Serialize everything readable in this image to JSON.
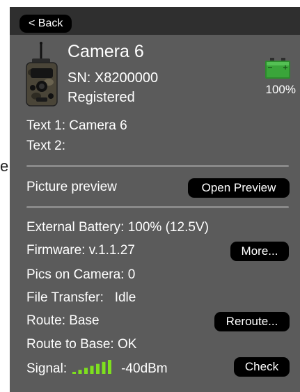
{
  "stray_char": "e",
  "nav": {
    "back_label": "< Back"
  },
  "camera": {
    "name": "Camera 6",
    "serial": "SN: X8200000",
    "status": "Registered",
    "battery_percent": "100%",
    "battery_level": 1.0,
    "image_icon": "trail-camera-icon",
    "battery_icon": "battery-icon"
  },
  "texts": {
    "text1": "Text 1: Camera 6",
    "text2": "Text 2:"
  },
  "preview": {
    "label": "Picture preview",
    "button": "Open Preview"
  },
  "info": {
    "external_battery": "External Battery: 100% (12.5V)",
    "firmware": "Firmware: v.1.1.27",
    "more_button": "More...",
    "pics": "Pics on Camera: 0",
    "file_transfer": "File Transfer:   Idle",
    "route": "Route: Base",
    "reroute_button": "Reroute...",
    "route_to_base": "Route to Base: OK",
    "signal_label": "Signal:",
    "signal_value": "-40dBm",
    "signal_bars": 7,
    "signal_icon": "signal-strength-icon",
    "check_button": "Check"
  },
  "colors": {
    "background": "#5b5b5b",
    "nav_bar": "#2f2f2f",
    "button": "#000000",
    "text": "#ffffff",
    "signal": "#7ee01e",
    "battery": "#3aa53a"
  }
}
